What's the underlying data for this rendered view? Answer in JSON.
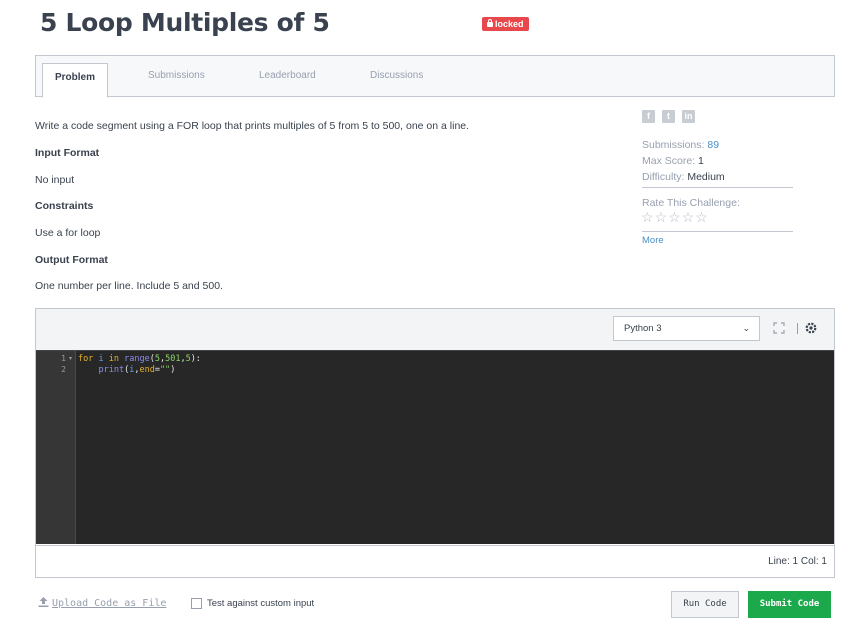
{
  "header": {
    "title": "5 Loop Multiples of 5",
    "badge": "locked"
  },
  "tabs": [
    {
      "label": "Problem",
      "active": true
    },
    {
      "label": "Submissions",
      "active": false
    },
    {
      "label": "Leaderboard",
      "active": false
    },
    {
      "label": "Discussions",
      "active": false
    }
  ],
  "problem": {
    "statement": "Write a code segment using a FOR loop that prints multiples of 5 from 5 to 500, one on a line.",
    "input_format_heading": "Input Format",
    "input_format": "No input",
    "constraints_heading": "Constraints",
    "constraints": "Use a for loop",
    "output_format_heading": "Output Format",
    "output_format": "One number per line. Include 5 and 500."
  },
  "sidebar": {
    "social_icons": [
      "facebook-icon",
      "twitter-icon",
      "linkedin-icon"
    ],
    "submissions_label": "Submissions:",
    "submissions_value": "89",
    "max_score_label": "Max Score:",
    "max_score_value": "1",
    "difficulty_label": "Difficulty:",
    "difficulty_value": "Medium",
    "rate_label": "Rate This Challenge:",
    "rating": 0,
    "rating_max": 5,
    "more_link": "More"
  },
  "editor": {
    "language": "Python 3",
    "line_numbers": [
      "1",
      "2"
    ],
    "code_lines": [
      "for i in range(5,501,5):",
      "    print(i,end=\"\")"
    ],
    "status": "Line: 1 Col: 1",
    "background_color": "#272727"
  },
  "footer": {
    "upload_label": "Upload Code as File",
    "custom_input_label": "Test against custom input",
    "custom_input_checked": false,
    "run_button": "Run Code",
    "submit_button": "Submit Code",
    "submit_color": "#1ba94c"
  }
}
